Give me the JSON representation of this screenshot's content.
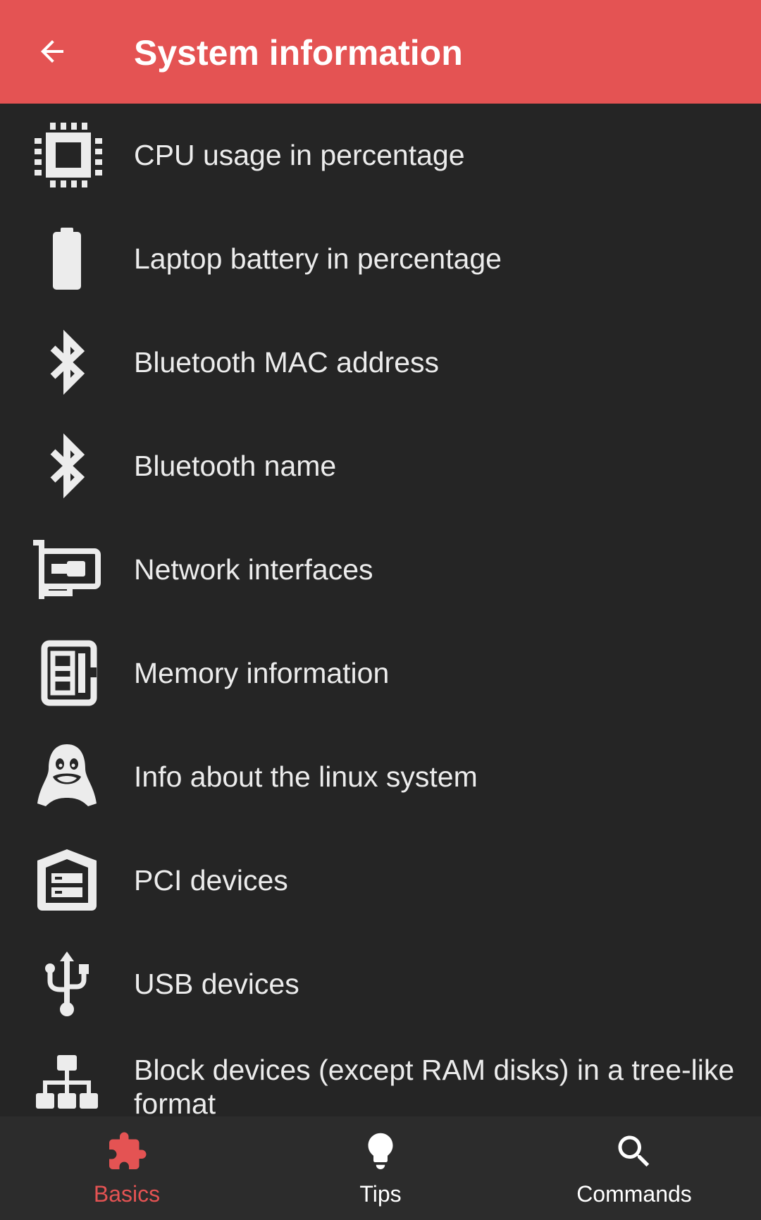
{
  "topbar": {
    "title": "System information",
    "back_icon": "arrow-back-icon",
    "background": "#e45353"
  },
  "list": {
    "items": [
      {
        "label": "CPU usage in percentage",
        "icon": "cpu-chip-icon"
      },
      {
        "label": "Laptop battery in percentage",
        "icon": "battery-icon"
      },
      {
        "label": "Bluetooth MAC address",
        "icon": "bluetooth-icon"
      },
      {
        "label": "Bluetooth name",
        "icon": "bluetooth-icon"
      },
      {
        "label": "Network interfaces",
        "icon": "network-card-icon"
      },
      {
        "label": "Memory information",
        "icon": "memory-icon"
      },
      {
        "label": "Info about the linux system",
        "icon": "linux-penguin-icon"
      },
      {
        "label": "PCI devices",
        "icon": "pci-devices-icon"
      },
      {
        "label": "USB devices",
        "icon": "usb-icon"
      },
      {
        "label": "Block devices (except RAM disks) in a tree-like format",
        "icon": "sitemap-tree-icon"
      }
    ]
  },
  "bottomnav": {
    "items": [
      {
        "label": "Basics",
        "icon": "puzzle-piece-icon",
        "active": true
      },
      {
        "label": "Tips",
        "icon": "lightbulb-icon",
        "active": false
      },
      {
        "label": "Commands",
        "icon": "search-icon",
        "active": false
      }
    ],
    "accent": "#e45353"
  }
}
